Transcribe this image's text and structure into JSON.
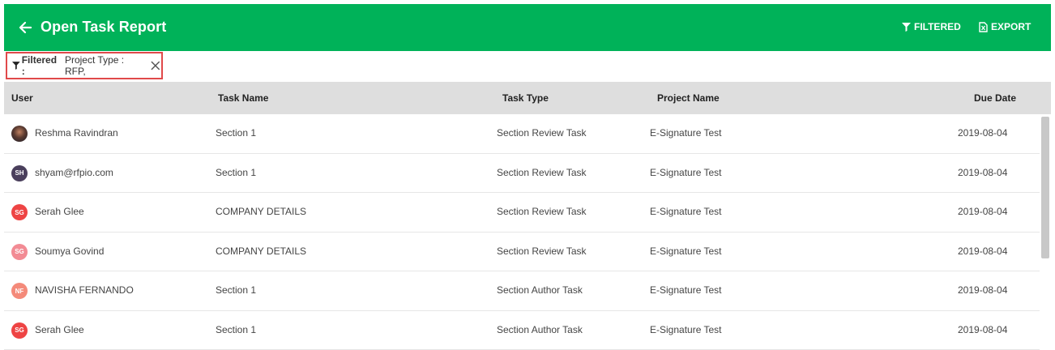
{
  "header": {
    "title": "Open Task Report",
    "filtered_label": "FILTERED",
    "export_label": "EXPORT",
    "bg_color": "#00b259"
  },
  "filter": {
    "prefix": "Filtered :",
    "value": "Project Type : RFP,"
  },
  "table": {
    "columns": [
      "User",
      "Task Name",
      "Task Type",
      "Project Name",
      "Due Date"
    ],
    "rows": [
      {
        "initials": "",
        "avatar_color": "#3a3550",
        "user": "Reshma Ravindran",
        "task_name": "Section 1",
        "task_type": "Section Review Task",
        "project_name": "E-Signature Test",
        "due_date": "2019-08-04"
      },
      {
        "initials": "SH",
        "avatar_color": "#4a3f5c",
        "user": "shyam@rfpio.com",
        "task_name": "Section 1",
        "task_type": "Section Review Task",
        "project_name": "E-Signature Test",
        "due_date": "2019-08-04"
      },
      {
        "initials": "SG",
        "avatar_color": "#ee4444",
        "user": "Serah Glee",
        "task_name": "COMPANY DETAILS",
        "task_type": "Section Review Task",
        "project_name": "E-Signature Test",
        "due_date": "2019-08-04"
      },
      {
        "initials": "SG",
        "avatar_color": "#f28b94",
        "user": "Soumya Govind",
        "task_name": "COMPANY DETAILS",
        "task_type": "Section Review Task",
        "project_name": "E-Signature Test",
        "due_date": "2019-08-04"
      },
      {
        "initials": "NF",
        "avatar_color": "#f48a7a",
        "user": "NAVISHA FERNANDO",
        "task_name": "Section 1",
        "task_type": "Section Author Task",
        "project_name": "E-Signature Test",
        "due_date": "2019-08-04"
      },
      {
        "initials": "SG",
        "avatar_color": "#ee4444",
        "user": "Serah Glee",
        "task_name": "Section 1",
        "task_type": "Section Author Task",
        "project_name": "E-Signature Test",
        "due_date": "2019-08-04"
      }
    ]
  }
}
